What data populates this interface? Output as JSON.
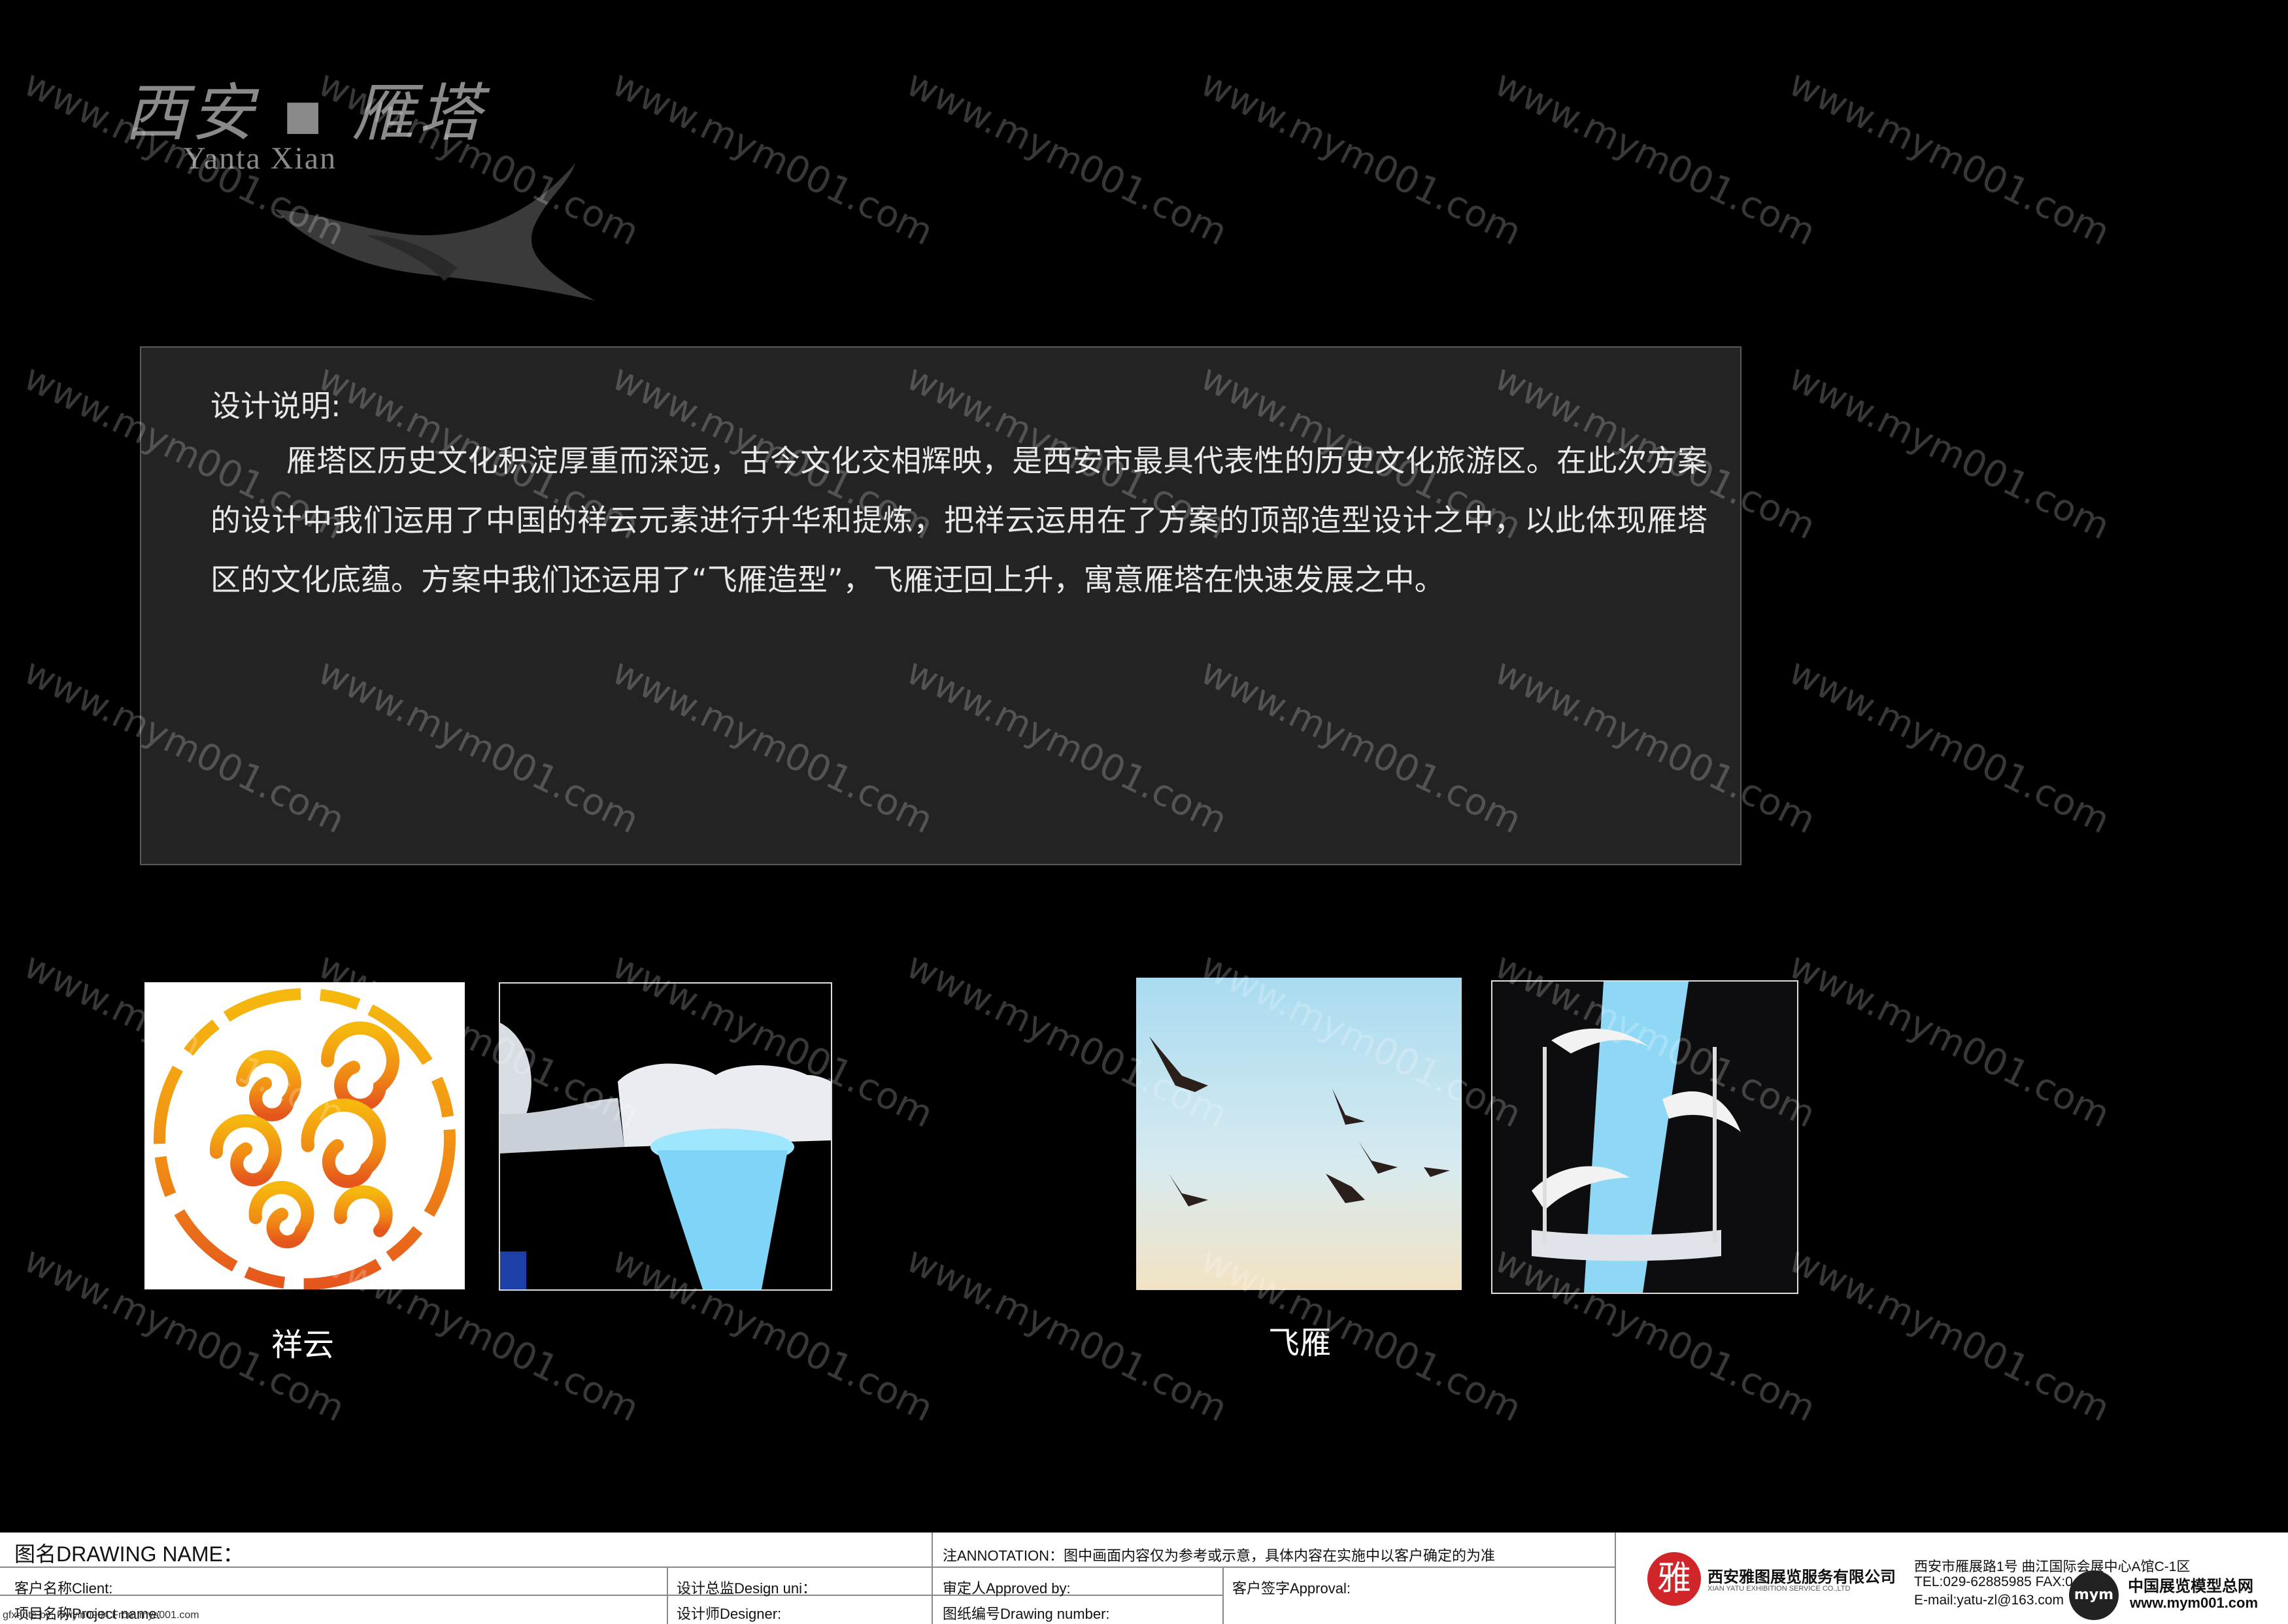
{
  "header": {
    "logo_cn": "西安 ▪ 雁塔",
    "logo_en": "Yanta Xian",
    "logo_icon": "flying-goose-icon"
  },
  "description": {
    "title": "设计说明:",
    "body": "雁塔区历史文化积淀厚重而深远，古今文化交相辉映，是西安市最具代表性的历史文化旅游区。在此次方案的设计中我们运用了中国的祥云元素进行升华和提炼，把祥云运用在了方案的顶部造型设计之中，以此体现雁塔区的文化底蕴。方案中我们还运用了“飞雁造型”，飞雁迂回上升，寓意雁塔在快速发展之中。"
  },
  "images": {
    "cloud_caption": "祥云",
    "geese_caption": "飞雁"
  },
  "watermark": "www.mym001.com",
  "title_block": {
    "drawing_name_label": "图名DRAWING NAME：",
    "client_label": "客户名称Client:",
    "project_label": "项目名称Project name:",
    "design_director_label": "设计总监Design uni：",
    "designer_label": "设计师Designer:",
    "annotation": "注ANNOTATION：图中画面内容仅为参考或示意，具体内容在实施中以客户确定的为准",
    "approved_label": "审定人Approved  by:",
    "drawing_number_label": "图纸编号Drawing number:",
    "client_signature_label": "客户签字Approval:",
    "company_cn": "西安雅图展览服务有限公司",
    "company_en": "XIAN YATU EXHIBITION SERVICE CO.,LTD",
    "company_logo_char": "雅",
    "address": "西安市雁展路1号  曲江国际会展中心A馆C-1区",
    "tel": "TEL:029-62885985   FAX:0",
    "email": "E-mail:yatu-zl@163.com",
    "site_name": "中国展览模型总网",
    "site_url": "www.mym001.com",
    "site_badge": "mym",
    "footnote": "gfxnote by: Ivyiyin0904 From:mya001.com",
    "brand_color": "#d0262a"
  }
}
